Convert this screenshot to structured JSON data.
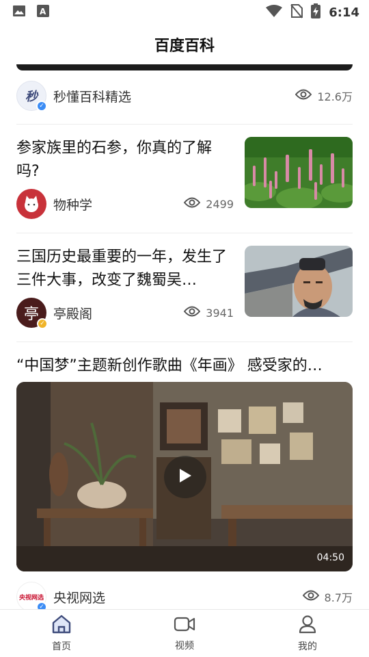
{
  "status_bar": {
    "time": "6:14",
    "left_icons": [
      "image-icon",
      "font-icon"
    ],
    "right_icons": [
      "wifi-icon",
      "no-sim-icon",
      "battery-charging-icon"
    ]
  },
  "header": {
    "title": "百度百科"
  },
  "feed": {
    "top_item": {
      "source": "秒懂百科精选",
      "views": "12.6万",
      "avatar_text": "秒"
    },
    "articles": [
      {
        "title": "参家族里的石参，你真的了解吗?",
        "source": "物种学",
        "views": "2499"
      },
      {
        "title": "三国历史最重要的一年，发生了三件大事，改变了魏蜀吴…",
        "source": "亭殿阁",
        "views": "3941",
        "avatar_text": "亭"
      }
    ],
    "video": {
      "title": "“中国梦”主题新创作歌曲《年画》 感受家的…",
      "duration": "04:50",
      "source": "央视网选",
      "views": "8.7万",
      "avatar_text": "央视网选"
    }
  },
  "bottom_nav": {
    "items": [
      {
        "label": "首页",
        "icon": "home-icon"
      },
      {
        "label": "视频",
        "icon": "video-icon"
      },
      {
        "label": "我的",
        "icon": "profile-icon"
      }
    ]
  },
  "colors": {
    "accent": "#3d4a7a",
    "verified_blue": "#3b8cf5",
    "verified_gold": "#f0b429"
  }
}
